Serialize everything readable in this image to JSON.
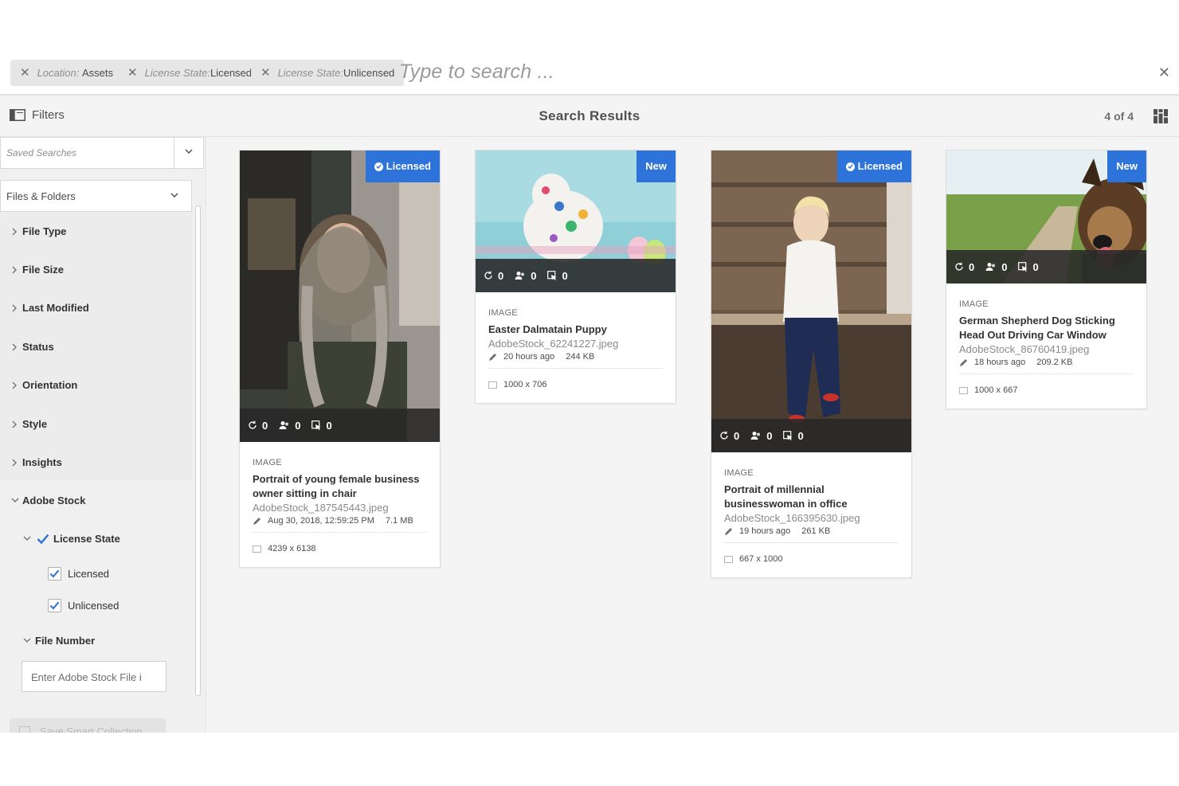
{
  "search": {
    "tags": [
      {
        "key": "Location:",
        "value": "Assets"
      },
      {
        "key": "License State:",
        "value": "Licensed"
      },
      {
        "key": "License State:",
        "value": "Unlicensed"
      }
    ],
    "placeholder": "Type to search ..."
  },
  "toolbar": {
    "filters_label": "Filters",
    "title": "Search Results",
    "count": "4 of 4"
  },
  "sidebar": {
    "saved_searches_placeholder": "Saved Searches",
    "files_folders": "Files & Folders",
    "facets": [
      "File Type",
      "File Size",
      "Last Modified",
      "Status",
      "Orientation",
      "Style",
      "Insights"
    ],
    "adobe_stock": "Adobe Stock",
    "license_state": "License State",
    "licensed": "Licensed",
    "unlicensed": "Unlicensed",
    "file_number": "File Number",
    "file_number_placeholder": "Enter Adobe Stock File i",
    "save_smart_collection": "Save Smart Collection"
  },
  "cards": [
    {
      "badge": "Licensed",
      "stats": [
        "0",
        "0",
        "0"
      ],
      "type": "IMAGE",
      "title": "Portrait of young female business owner sitting in chair",
      "file": "AdobeStock_187545443.jpeg",
      "modified": "Aug 30, 2018, 12:59:25 PM",
      "size": "7.1 MB",
      "dims": "4239 x 6138"
    },
    {
      "badge": "New",
      "stats": [
        "0",
        "0",
        "0"
      ],
      "type": "IMAGE",
      "title": "Easter Dalmatain Puppy",
      "file": "AdobeStock_62241227.jpeg",
      "modified": "20 hours ago",
      "size": "244 KB",
      "dims": "1000 x 706"
    },
    {
      "badge": "Licensed",
      "stats": [
        "0",
        "0",
        "0"
      ],
      "type": "IMAGE",
      "title": "Portrait of millennial businesswoman in office",
      "file": "AdobeStock_166395630.jpeg",
      "modified": "19 hours ago",
      "size": "261 KB",
      "dims": "667 x 1000"
    },
    {
      "badge": "New",
      "stats": [
        "0",
        "0",
        "0"
      ],
      "type": "IMAGE",
      "title": "German Shepherd Dog Sticking Head Out Driving Car Window",
      "file": "AdobeStock_86760419.jpeg",
      "modified": "18 hours ago",
      "size": "209.2 KB",
      "dims": "1000 x 667"
    }
  ],
  "colors": {
    "accent": "#2d73da",
    "statbar": "#282828",
    "panel": "#f0f0f0",
    "grid_bg": "#f4f4f4"
  }
}
